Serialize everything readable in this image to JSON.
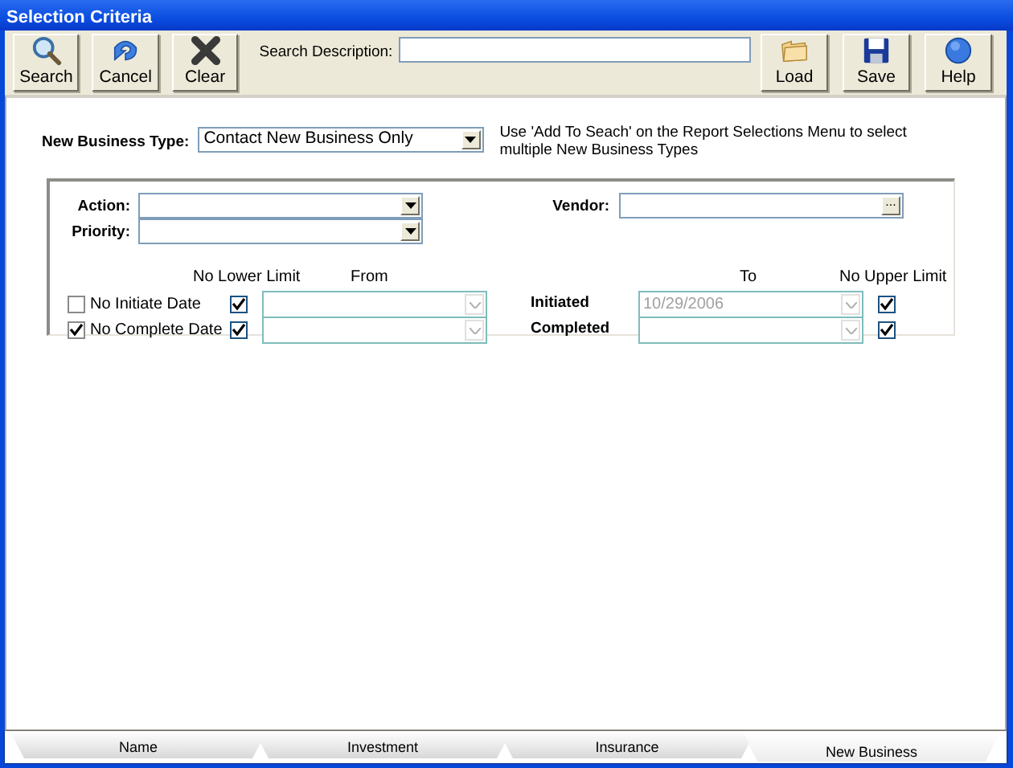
{
  "window": {
    "title": "Selection Criteria"
  },
  "toolbar": {
    "left_buttons": [
      {
        "label": "Search",
        "kind": "search"
      },
      {
        "label": "Cancel",
        "kind": "undo"
      },
      {
        "label": "Clear",
        "kind": "clear"
      }
    ],
    "search_description": {
      "label": "Search Description:"
    },
    "right_buttons": [
      {
        "label": "Load",
        "kind": "folder"
      },
      {
        "label": "Save",
        "kind": "disk"
      },
      {
        "label": "Help",
        "kind": "help"
      }
    ]
  },
  "new_business_type": {
    "label": "New Business Type:",
    "value": "Contact New Business Only",
    "note": "Use 'Add To Seach' on the Report Selections Menu to select multiple New Business Types"
  },
  "criteria": {
    "action": {
      "label": "Action:"
    },
    "priority": {
      "label": "Priority:"
    },
    "vendor": {
      "label": "Vendor:",
      "button": "..."
    }
  },
  "date_headers": [
    "No Lower Limit",
    "From",
    "To",
    "No Upper Limit"
  ],
  "date_rows": [
    {
      "label": "No Initiate Date",
      "checked": false,
      "no_lower_limit": true,
      "range_label": "Initiated",
      "to_value": "10/29/2006",
      "no_upper_limit": true
    },
    {
      "label": "No Complete Date",
      "checked": true,
      "no_lower_limit": true,
      "range_label": "Completed",
      "no_upper_limit": true
    }
  ],
  "tabs": [
    {
      "label": "Name",
      "selected": false
    },
    {
      "label": "Investment",
      "selected": false
    },
    {
      "label": "Insurance",
      "selected": false
    },
    {
      "label": "New Business",
      "selected": true
    }
  ]
}
